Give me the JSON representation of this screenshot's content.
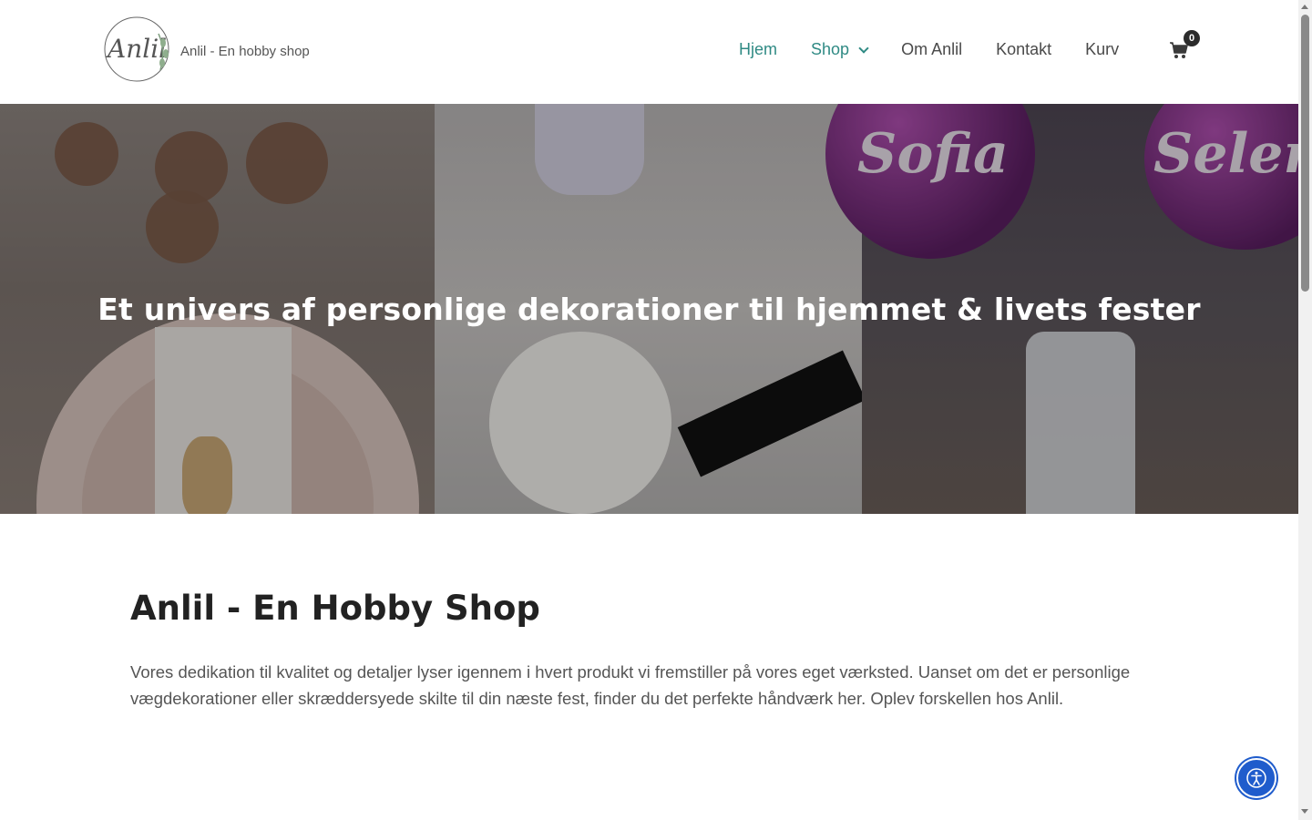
{
  "header": {
    "logo_script": "Anlil",
    "logo_text": "Anlil - En hobby shop",
    "nav": [
      {
        "label": "Hjem"
      },
      {
        "label": "Shop"
      },
      {
        "label": "Om Anlil"
      },
      {
        "label": "Kontakt"
      },
      {
        "label": "Kurv"
      }
    ],
    "cart_count": "0"
  },
  "hero": {
    "title": "Et univers af personlige dekorationer til hjemmet & livets fester",
    "ball_names": [
      "Sofia",
      "Selen"
    ]
  },
  "content": {
    "title": "Anlil - En Hobby Shop",
    "text": "Vores dedikation til kvalitet og detaljer lyser igennem i hvert produkt vi fremstiller på vores eget værksted. Uanset om det er personlige vægdekorationer eller skræddersyede skilte til din næste fest, finder du det perfekte håndværk her. Oplev forskellen hos Anlil."
  },
  "colors": {
    "accent": "#2f8a84",
    "accessibility": "#1f5ccc"
  },
  "icons": {
    "cart": "shopping-cart-icon",
    "shop_dropdown": "chevron-down-icon",
    "accessibility": "accessibility-icon"
  }
}
